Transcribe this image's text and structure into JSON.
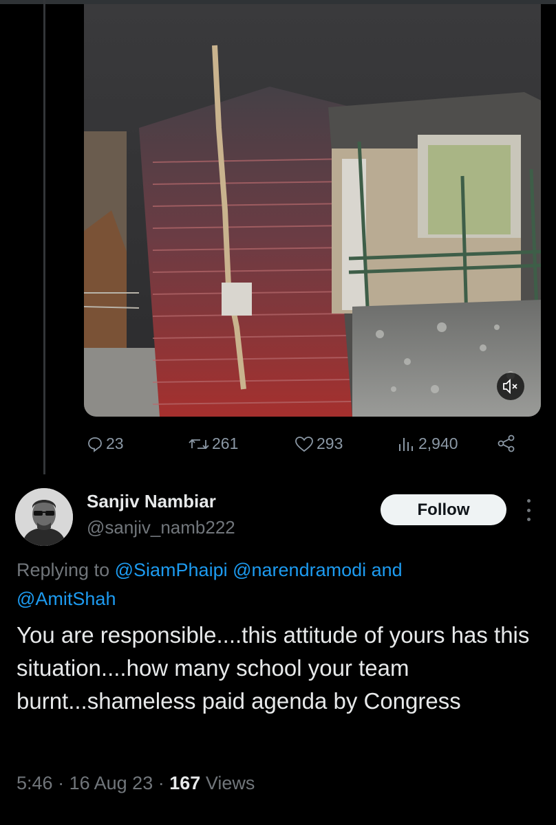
{
  "tweet_actions": {
    "replies": "23",
    "retweets": "261",
    "likes": "293",
    "views": "2,940"
  },
  "reply": {
    "author_name": "Sanjiv Nambiar",
    "author_handle": "@sanjiv_namb222",
    "follow_label": "Follow",
    "replying_prefix": "Replying to",
    "mentions": [
      "@SiamPhaipi",
      "@narendramodi",
      "@AmitShah"
    ],
    "mention_joiner": "and",
    "text": "You are responsible....this attitude of yours has this situation....how many school your team burnt...shameless paid agenda by Congress",
    "time": "5:46",
    "date": "16 Aug 23",
    "view_count": "167",
    "views_label": "Views"
  },
  "colors": {
    "background": "#000000",
    "text": "#e7e9ea",
    "muted": "#71767b",
    "link": "#1d9bf0",
    "follow_bg": "#eff3f4"
  },
  "icons": [
    "reply-icon",
    "retweet-icon",
    "like-icon",
    "views-icon",
    "share-icon",
    "mute-icon",
    "more-icon"
  ]
}
